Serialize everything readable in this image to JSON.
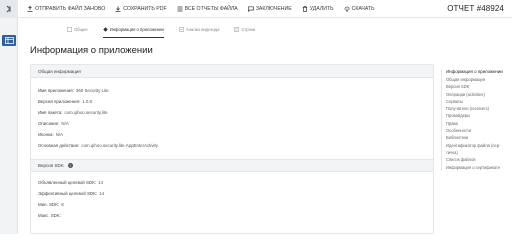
{
  "toolbar": {
    "buttons": [
      {
        "label": "ОТПРАВИТЬ ФАЙЛ ЗАНОВО",
        "icon": "upload-icon"
      },
      {
        "label": "СОХРАНИТЬ PDF",
        "icon": "download-icon"
      },
      {
        "label": "ВСЕ ОТЧЕТЫ ФАЙЛА",
        "icon": "list-icon"
      },
      {
        "label": "ЗАКЛЮЧЕНИЕ",
        "icon": "chat-icon"
      },
      {
        "label": "УДАЛИТЬ",
        "icon": "trash-icon"
      },
      {
        "label": "СКАЧАТЬ",
        "icon": "cloud-download-icon"
      }
    ],
    "report_title": "ОТЧЕТ #48924"
  },
  "tabs": [
    {
      "label": "Общее",
      "active": false,
      "icon": "info-icon"
    },
    {
      "label": "Информация о приложении",
      "active": true,
      "icon": "app-icon"
    },
    {
      "label": "Анализ индекода",
      "active": false,
      "icon": "code-icon"
    },
    {
      "label": "Строки",
      "active": false,
      "icon": "strings-icon"
    }
  ],
  "page_title": "Информация о приложении",
  "general": {
    "header": "Общая информация",
    "rows": [
      {
        "label": "Имя приложения:",
        "value": "360 Security Lite"
      },
      {
        "label": "Версия приложения:",
        "value": "1.0.8"
      },
      {
        "label": "Имя пакета:",
        "value": "com.qihoo.security.lite"
      },
      {
        "label": "Описание:",
        "value": "N/A"
      },
      {
        "label": "Иконка:",
        "value": "N/A"
      },
      {
        "label": "Основная действие:",
        "value": "com.qihoo.security.lite.AppEnterActivity"
      }
    ]
  },
  "sdk": {
    "header": "Версия SDK",
    "rows": [
      {
        "label": "Объявленный целевой SDK:",
        "value": "14"
      },
      {
        "label": "Эффективный целевой SDK:",
        "value": "14"
      },
      {
        "label": "Мин. SDK:",
        "value": "8"
      },
      {
        "label": "Макс. SDK:",
        "value": ""
      }
    ]
  },
  "rnav": {
    "title": "Информация о приложении",
    "items": [
      "Общая информация",
      "Версия SDK",
      "Операции (activities)",
      "Сервисы",
      "Получатели (receivers)",
      "Провайдеры",
      "Права",
      "Особенности",
      "Библиотеки",
      "Идентификатор файла (сер-",
      "тичка)",
      "Список файлов",
      "Информация о сертификате"
    ]
  },
  "colors": {
    "rail_active": "#2f5f9e",
    "header_bg": "#f2f4f6"
  }
}
